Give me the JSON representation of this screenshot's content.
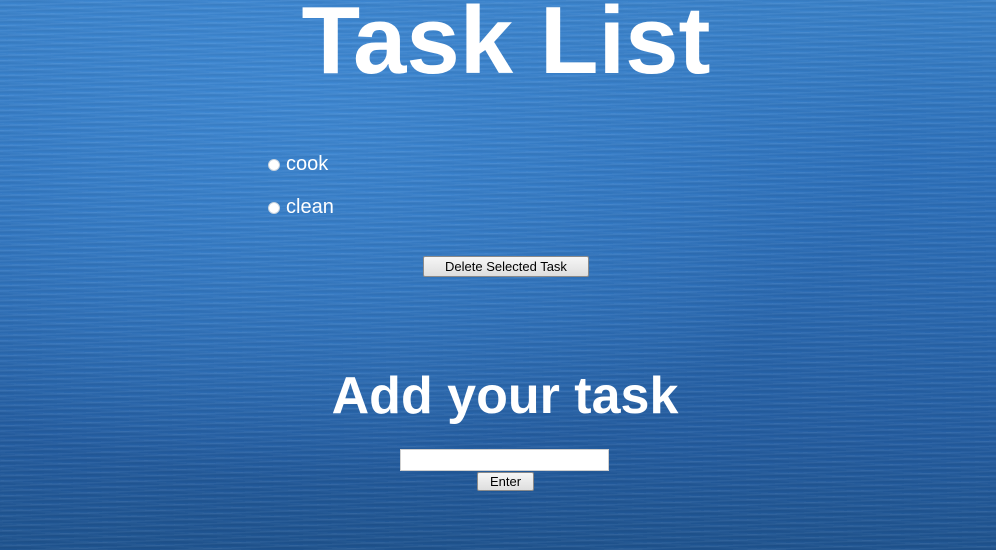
{
  "header": {
    "title": "Task List"
  },
  "tasks": {
    "items": [
      {
        "label": "cook",
        "selected": false
      },
      {
        "label": "clean",
        "selected": false
      }
    ]
  },
  "actions": {
    "delete_label": "Delete Selected Task"
  },
  "add_section": {
    "title": "Add your task",
    "input_value": "",
    "enter_label": "Enter"
  },
  "colors": {
    "background": "#2e73bf",
    "text": "#ffffff"
  }
}
